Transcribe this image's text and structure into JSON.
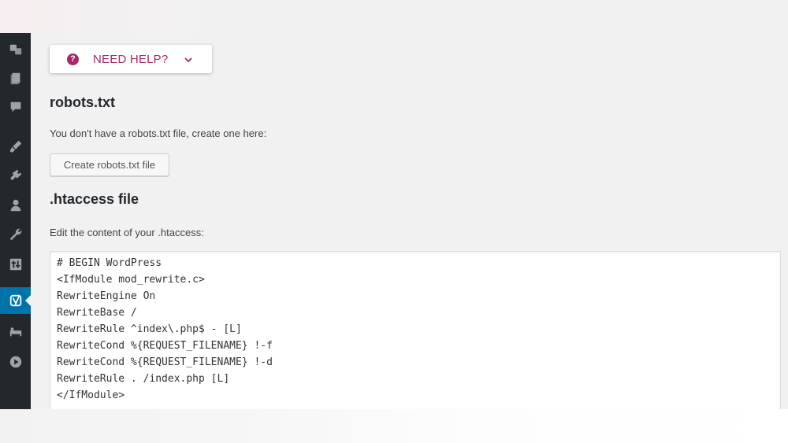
{
  "sidebar": {
    "items": [
      {
        "icon": "seo-translate-icon"
      },
      {
        "icon": "pages-icon"
      },
      {
        "icon": "comments-icon"
      },
      {
        "icon": "appearance-brush-icon"
      },
      {
        "icon": "plugins-icon"
      },
      {
        "icon": "users-icon"
      },
      {
        "icon": "tools-wrench-icon"
      },
      {
        "icon": "settings-sliders-icon"
      },
      {
        "icon": "yoast-seo-icon",
        "active": true
      },
      {
        "icon": "bed-icon"
      },
      {
        "icon": "play-icon"
      }
    ],
    "active_color": "#0073aa",
    "background": "#23282d"
  },
  "help": {
    "label": "NEED HELP?",
    "icon": "question-circle-icon",
    "color": "#a4286a"
  },
  "robots": {
    "title": "robots.txt",
    "description": "You don't have a robots.txt file, create one here:",
    "button_label": "Create robots.txt file"
  },
  "htaccess": {
    "title": ".htaccess file",
    "description": "Edit the content of your .htaccess:",
    "lines": [
      "# BEGIN WordPress",
      "<IfModule mod_rewrite.c>",
      "RewriteEngine On",
      "RewriteBase /",
      "RewriteRule ^index\\.php$ - [L]",
      "RewriteCond %{REQUEST_FILENAME} !-f",
      "RewriteCond %{REQUEST_FILENAME} !-d",
      "RewriteRule . /index.php [L]",
      "</IfModule>"
    ]
  }
}
